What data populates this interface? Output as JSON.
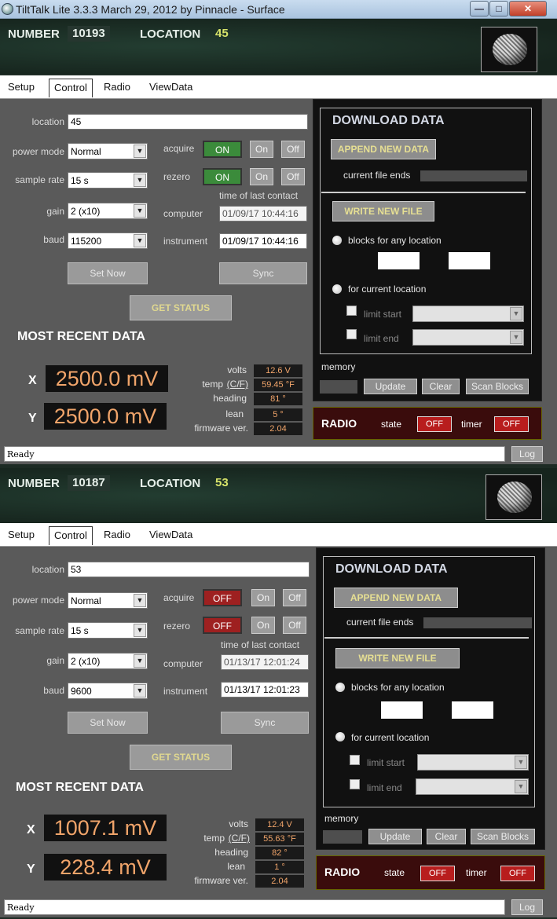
{
  "window": {
    "title": "TiltTalk Lite 3.3.3 March 29, 2012  by Pinnacle - Surface"
  },
  "labels": {
    "number": "NUMBER",
    "location_hdr": "LOCATION",
    "location": "location",
    "power_mode": "power mode",
    "sample_rate": "sample rate",
    "gain": "gain",
    "baud": "baud",
    "acquire": "acquire",
    "rezero": "rezero",
    "time_last_contact": "time of last contact",
    "computer": "computer",
    "instrument": "instrument",
    "set_now": "Set Now",
    "sync": "Sync",
    "get_status": "GET STATUS",
    "most_recent": "MOST RECENT DATA",
    "x": "X",
    "y": "Y",
    "volts": "volts",
    "temp": "temp",
    "temp_unit": "(C/F)",
    "heading": "heading",
    "lean": "lean",
    "firmware": "firmware ver.",
    "on": "On",
    "off": "Off",
    "download_data": "DOWNLOAD DATA",
    "append_new_data": "APPEND NEW DATA",
    "current_file_ends": "current file ends",
    "write_new_file": "WRITE NEW FILE",
    "blocks_any": "blocks for any location",
    "for_current": "for current location",
    "limit_start": "limit start",
    "limit_end": "limit end",
    "memory": "memory",
    "update": "Update",
    "clear": "Clear",
    "scan_blocks": "Scan Blocks",
    "radio": "RADIO",
    "state": "state",
    "timer": "timer",
    "log": "Log"
  },
  "tabs": [
    "Setup",
    "Control",
    "Radio",
    "ViewData"
  ],
  "panels": [
    {
      "number": "10193",
      "location_hdr": "45",
      "location": "45",
      "power_mode": "Normal",
      "sample_rate": "15 s",
      "gain": "2 (x10)",
      "baud": "115200",
      "acquire": "ON",
      "rezero": "ON",
      "computer_time": "01/09/17 10:44:16",
      "instrument_time": "01/09/17 10:44:16",
      "x": "2500.0 mV",
      "y": "2500.0 mV",
      "volts": "12.6 V",
      "temp": "59.45 °F",
      "heading": "81 °",
      "lean": "5 °",
      "firmware": "2.04",
      "radio_state": "OFF",
      "radio_timer": "OFF",
      "status": "Ready"
    },
    {
      "number": "10187",
      "location_hdr": "53",
      "location": "53",
      "power_mode": "Normal",
      "sample_rate": "15 s",
      "gain": "2 (x10)",
      "baud": "9600",
      "acquire": "OFF",
      "rezero": "OFF",
      "computer_time": "01/13/17 12:01:24",
      "instrument_time": "01/13/17 12:01:23",
      "x": "1007.1 mV",
      "y": "228.4 mV",
      "volts": "12.4 V",
      "temp": "55.63 °F",
      "heading": "82 °",
      "lean": "1 °",
      "firmware": "2.04",
      "radio_state": "OFF",
      "radio_timer": "OFF",
      "status": "Ready"
    }
  ],
  "colors": {
    "on": "#3b8b3b",
    "off": "#9e2020",
    "readout": "#f0a46a",
    "location_accent": "#d7e36a"
  }
}
